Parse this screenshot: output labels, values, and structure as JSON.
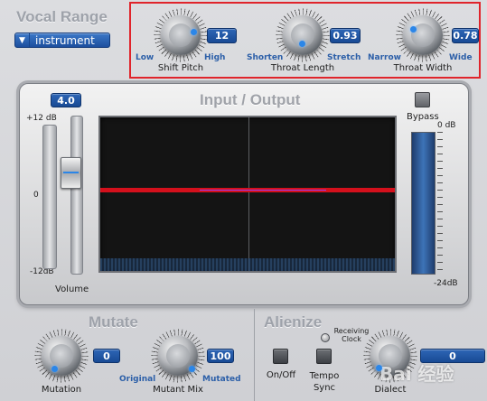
{
  "vocal_range": {
    "title": "Vocal Range",
    "dropdown_value": "instrument",
    "knobs": [
      {
        "name": "Shift Pitch",
        "value": "12",
        "low": "Low",
        "high": "High"
      },
      {
        "name": "Throat Length",
        "value": "0.93",
        "low": "Shorten",
        "high": "Stretch"
      },
      {
        "name": "Throat Width",
        "value": "0.78",
        "low": "Narrow",
        "high": "Wide"
      }
    ]
  },
  "io_panel": {
    "title": "Input / Output",
    "volume_value": "4.0",
    "volume_label": "Volume",
    "volume_scale": [
      "+12 dB",
      "0",
      "-12dB"
    ],
    "bypass_label": "Bypass",
    "meter_scale": [
      "0 dB",
      "-24dB"
    ]
  },
  "mutate": {
    "title": "Mutate",
    "knobs": [
      {
        "name": "Mutation",
        "value": "0"
      },
      {
        "name": "Mutant Mix",
        "value": "100",
        "low": "Original",
        "high": "Mutated"
      }
    ]
  },
  "alienize": {
    "title": "Alienize",
    "receiving_clock": "Receiving Clock",
    "on_off": "On/Off",
    "tempo_sync": "Tempo Sync",
    "dialect_label": "Dialect",
    "dialect_value": "0"
  },
  "watermark": "Bai 经验",
  "colors": {
    "accent_blue": "#2b86e8",
    "highlight_red": "#e0242b",
    "trace_red": "#e01020",
    "trace_purple": "#9a3df0"
  }
}
